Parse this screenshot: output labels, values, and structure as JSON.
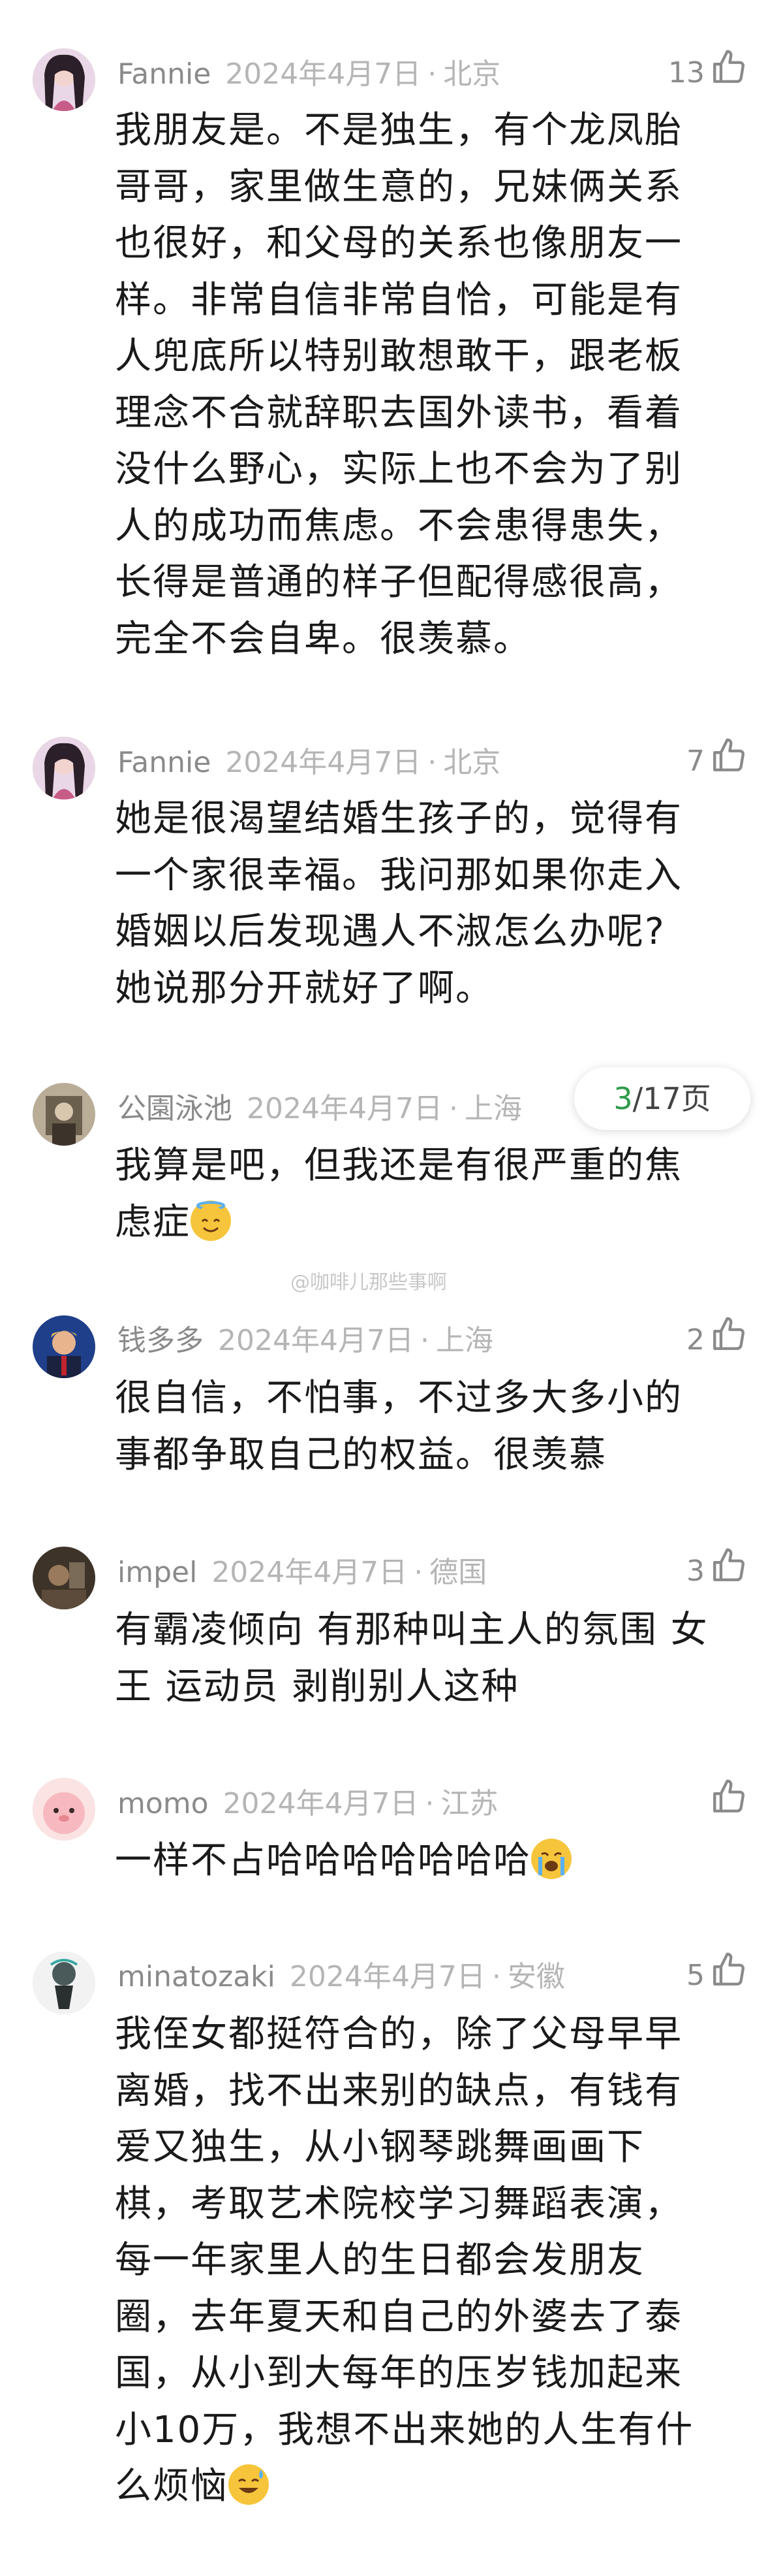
{
  "comments": [
    {
      "name": "Fannie",
      "date": "2024年4月7日",
      "location": "北京",
      "likes": "13",
      "lines": [
        "我朋友是。不是独生，有个龙凤胎",
        "哥哥，家里做生意的，兄妹俩关系",
        "也很好，和父母的关系也像朋友一",
        "样。非常自信非常自恰，可能是有",
        "人兜底所以特别敢想敢干，跟老板",
        "理念不合就辞职去国外读书，看着",
        "没什么野心，实际上也不会为了别",
        "人的成功而焦虑。不会患得患失，",
        "长得是普通的样子但配得感很高，",
        "完全不会自卑。很羡慕。"
      ]
    },
    {
      "name": "Fannie",
      "date": "2024年4月7日",
      "location": "北京",
      "likes": "7",
      "lines": [
        "她是很渴望结婚生孩子的，觉得有",
        "一个家很幸福。我问那如果你走入",
        "婚姻以后发现遇人不淑怎么办呢?",
        "她说那分开就好了啊。"
      ]
    },
    {
      "name": "公園泳池",
      "date": "2024年4月7日",
      "location": "上海",
      "likes": "",
      "lines": [
        "我算是吧，但我还是有很严重的焦",
        "虑症"
      ]
    },
    {
      "name": "钱多多",
      "date": "2024年4月7日",
      "location": "上海",
      "likes": "2",
      "lines": [
        "很自信，不怕事，不过多大多小的",
        "事都争取自己的权益。很羡慕"
      ]
    },
    {
      "name": "impel",
      "date": "2024年4月7日",
      "location": "德国",
      "likes": "3",
      "lines": [
        "有霸凌倾向 有那种叫主人的氛围 女",
        "王 运动员 剥削别人这种"
      ]
    },
    {
      "name": "momo",
      "date": "2024年4月7日",
      "location": "江苏",
      "likes": "",
      "lines": [
        "一样不占哈哈哈哈哈哈哈"
      ]
    },
    {
      "name": "minatozaki",
      "date": "2024年4月7日",
      "location": "安徽",
      "likes": "5",
      "lines": [
        "我侄女都挺符合的，除了父母早早",
        "离婚，找不出来别的缺点，有钱有",
        "爱又独生，从小钢琴跳舞画画下",
        "棋，考取艺术院校学习舞蹈表演，",
        "每一年家里人的生日都会发朋友",
        "圈，去年夏天和自己的外婆去了泰",
        "国，从小到大每年的压岁钱加起来",
        "小10万，我想不出来她的人生有什",
        "么烦恼"
      ]
    }
  ],
  "pager": {
    "current": "3",
    "total": "/17页"
  },
  "watermark": "@咖啡儿那些事啊",
  "icons": {
    "like": "thumbs-up-icon",
    "separator": "·"
  },
  "colors": {
    "name": "#8a8a8a",
    "meta": "#b5b5b5",
    "pager_current": "#2e9b4a"
  }
}
